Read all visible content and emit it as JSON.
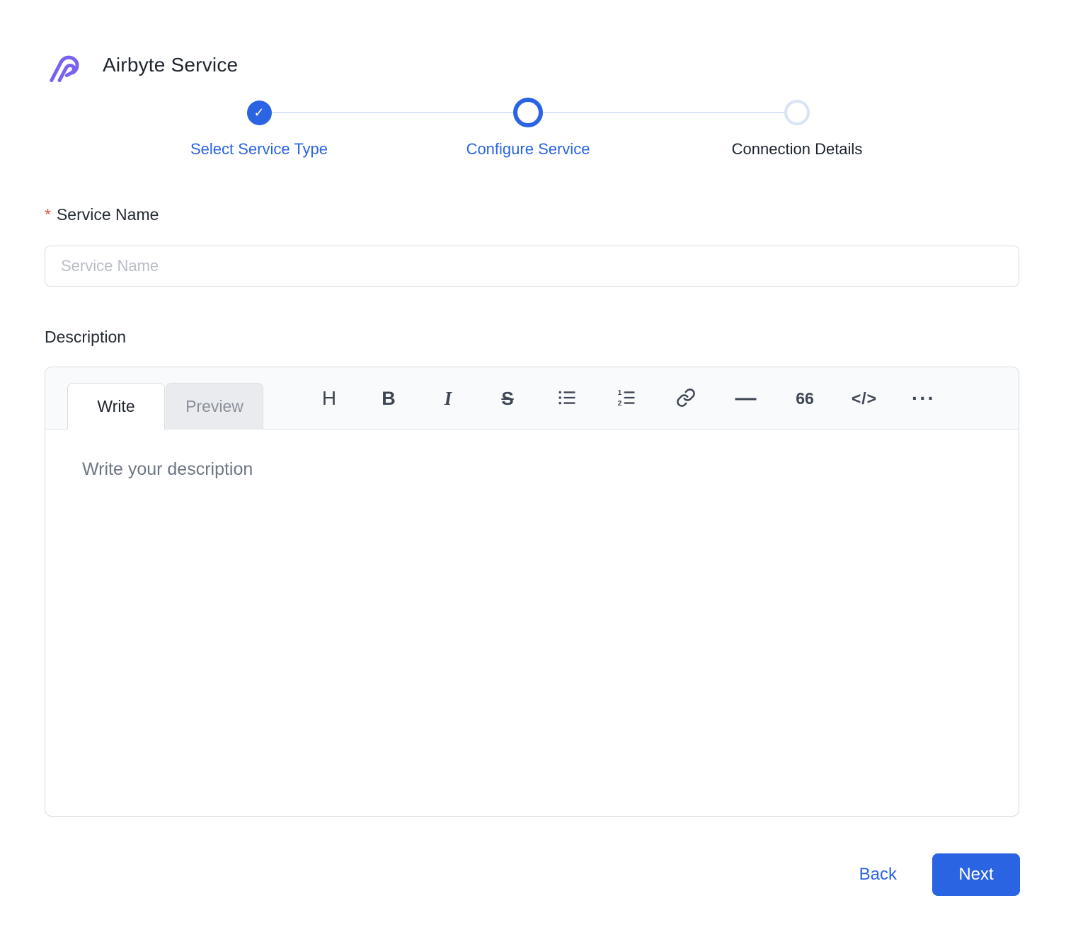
{
  "header": {
    "title": "Airbyte Service"
  },
  "stepper": {
    "steps": [
      {
        "label": "Select Service Type",
        "state": "completed"
      },
      {
        "label": "Configure Service",
        "state": "active"
      },
      {
        "label": "Connection Details",
        "state": "upcoming"
      }
    ]
  },
  "form": {
    "service_name": {
      "required_mark": "*",
      "label": "Service Name",
      "placeholder": "Service Name",
      "value": ""
    },
    "description": {
      "label": "Description"
    }
  },
  "editor": {
    "tabs": {
      "write": "Write",
      "preview": "Preview"
    },
    "toolbar": {
      "icons": [
        "header-icon",
        "bold-icon",
        "italic-icon",
        "strikethrough-icon",
        "unordered-list-icon",
        "ordered-list-icon",
        "link-icon",
        "horizontal-rule-icon",
        "quote-icon",
        "code-icon",
        "more-icon"
      ],
      "glyphs": {
        "header": "H",
        "bold": "B",
        "italic": "I",
        "strikethrough": "S",
        "horizontal_rule": "—",
        "quote": "66",
        "code": "</>",
        "more": "···"
      }
    },
    "placeholder": "Write your description",
    "value": ""
  },
  "actions": {
    "back": "Back",
    "next": "Next"
  },
  "colors": {
    "accent_blue": "#2b64e3",
    "logo_purple": "#7b61f0",
    "step_line": "#d9e3f6",
    "upcoming_ring": "#d9e4f8",
    "text_dark": "#21262f",
    "muted_gray": "#8a9099",
    "border_gray": "#d8dce2",
    "toolbar_bg": "#f9fafb",
    "required_red": "#e0523e",
    "next_button_bg": "#2b64e3",
    "next_button_text": "#ffffff"
  }
}
